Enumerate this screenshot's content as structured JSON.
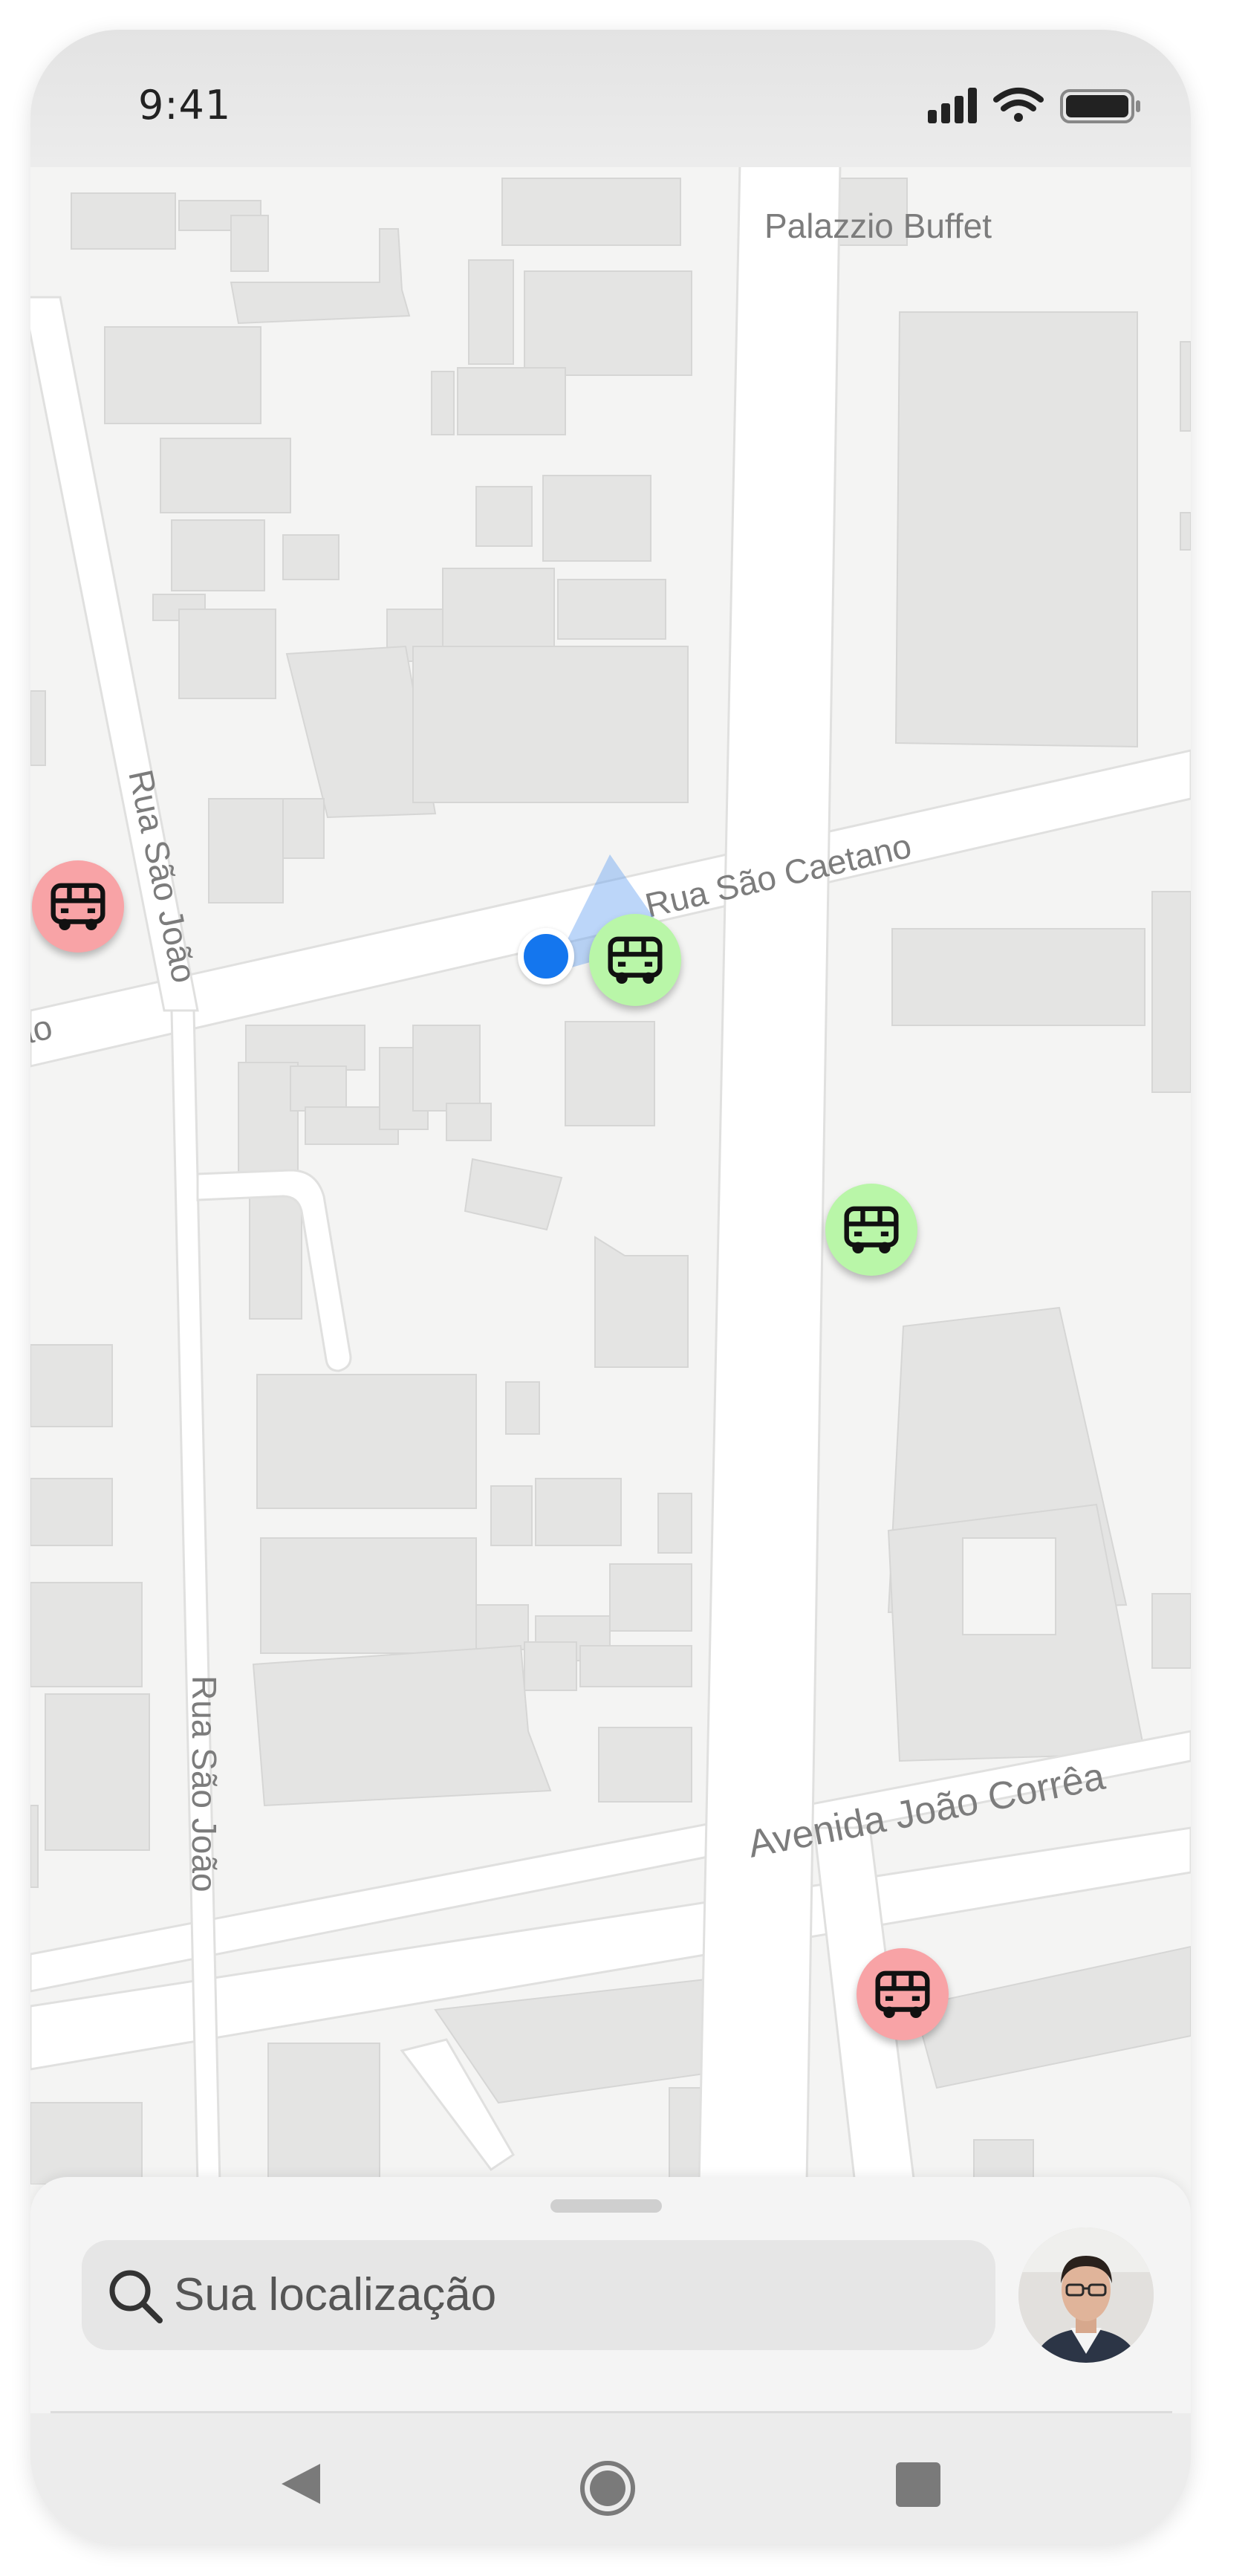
{
  "status_bar": {
    "time": "9:41"
  },
  "map": {
    "places": {
      "palazzio": "Palazzio Buffet"
    },
    "streets": {
      "sao_caetano": "Rua São Caetano",
      "sao_joao_upper": "Rua São João",
      "sao_joao_lower": "Rua São João",
      "joao_correa": "Avenida João Corrêa",
      "cut_label": "ão"
    },
    "bus_pins": [
      {
        "status": "inactive",
        "color": "#f8a3a6"
      },
      {
        "status": "active",
        "color": "#b9f6a8"
      },
      {
        "status": "active",
        "color": "#b9f6a8"
      },
      {
        "status": "inactive",
        "color": "#f8a3a6"
      }
    ],
    "user_location_color": "#1476ee"
  },
  "bottom_sheet": {
    "search": {
      "placeholder": "Sua localização"
    }
  },
  "nav_bar": {
    "items": [
      "back",
      "home",
      "recent-apps"
    ]
  }
}
